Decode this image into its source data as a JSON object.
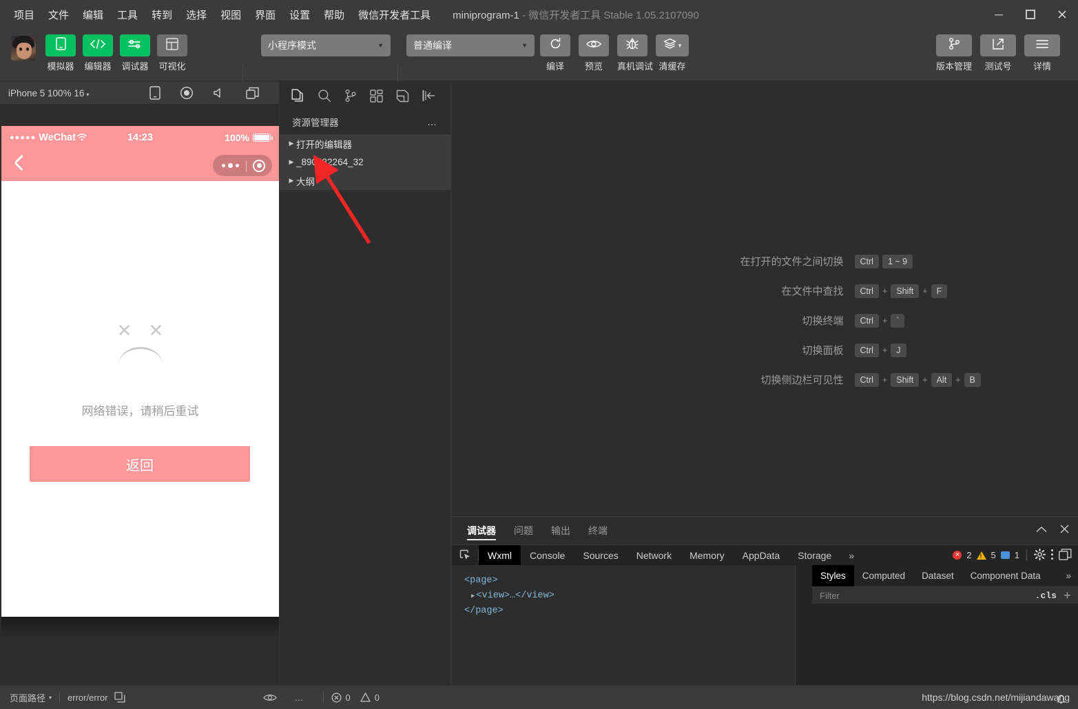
{
  "window": {
    "title_main": "miniprogram-1",
    "title_dash": "-",
    "title_sub": "微信开发者工具 Stable 1.05.2107090",
    "minimize": "minimize-button",
    "maximize": "maximize-button",
    "close": "close-button"
  },
  "menubar": {
    "items": [
      "项目",
      "文件",
      "编辑",
      "工具",
      "转到",
      "选择",
      "视图",
      "界面",
      "设置",
      "帮助",
      "微信开发者工具"
    ]
  },
  "toolbar": {
    "panel_buttons": [
      {
        "label": "模拟器",
        "icon": "phone-icon",
        "state": "active"
      },
      {
        "label": "编辑器",
        "icon": "code-icon",
        "state": "active"
      },
      {
        "label": "调试器",
        "icon": "debug-sliders-icon",
        "state": "active"
      },
      {
        "label": "可视化",
        "icon": "layout-icon",
        "state": "inactive"
      }
    ],
    "mode_select": {
      "value": "小程序模式",
      "caret": "▼"
    },
    "compile_select": {
      "value": "普通编译",
      "caret": "▼"
    },
    "actions": [
      {
        "label": "编译",
        "icon": "refresh-icon"
      },
      {
        "label": "预览",
        "icon": "eye-icon"
      },
      {
        "label": "真机调试",
        "icon": "bug-icon"
      },
      {
        "label": "清缓存",
        "icon": "layers-icon",
        "caret": "▾"
      }
    ],
    "right_actions": [
      {
        "label": "版本管理",
        "icon": "git-branch-icon"
      },
      {
        "label": "测试号",
        "icon": "external-link-icon"
      },
      {
        "label": "详情",
        "icon": "hamburger-icon"
      }
    ]
  },
  "simulator": {
    "device_label": "iPhone 5 100% 16",
    "device_caret": "▾",
    "toolbar_icons": [
      "device-rotate-icon",
      "record-icon",
      "volume-icon",
      "multi-window-icon"
    ],
    "status_bar": {
      "signal_dots": "●●●●●",
      "carrier": "WeChat",
      "wifi": "wifi-icon",
      "time": "14:23",
      "battery_percent": "100%"
    },
    "nav": {
      "back": "back-chevron-icon",
      "capsule_menu": "more-dots-icon",
      "capsule_target": "target-icon"
    },
    "page": {
      "face_icon": "sad-face-icon",
      "error_message": "网络错误，请稍后重试",
      "back_button": "返回"
    }
  },
  "explorer": {
    "activity_icons": [
      "files-icon",
      "search-icon",
      "source-control-icon",
      "extensions-icon",
      "snippets-icon",
      "collapse-sidebar-icon"
    ],
    "title": "资源管理器",
    "more": "…",
    "sections": [
      {
        "label": "打开的编辑器",
        "arrow": "▶"
      },
      {
        "label": "_890482264_32",
        "arrow": "▶"
      },
      {
        "label": "大纲",
        "arrow": "▶"
      }
    ]
  },
  "editor": {
    "shortcuts": [
      {
        "label": "在打开的文件之间切换",
        "keys": [
          "Ctrl",
          "1 ~ 9"
        ],
        "seps": [
          ""
        ]
      },
      {
        "label": "在文件中查找",
        "keys": [
          "Ctrl",
          "Shift",
          "F"
        ],
        "seps": [
          "+",
          "+"
        ]
      },
      {
        "label": "切换终端",
        "keys": [
          "Ctrl",
          "`"
        ],
        "seps": [
          "+"
        ]
      },
      {
        "label": "切换面板",
        "keys": [
          "Ctrl",
          "J"
        ],
        "seps": [
          "+"
        ]
      },
      {
        "label": "切换侧边栏可见性",
        "keys": [
          "Ctrl",
          "Shift",
          "Alt",
          "B"
        ],
        "seps": [
          "+",
          "+",
          "+"
        ]
      }
    ]
  },
  "debugger": {
    "panel_tabs": [
      {
        "label": "调试器",
        "active": true
      },
      {
        "label": "问题",
        "active": false
      },
      {
        "label": "输出",
        "active": false
      },
      {
        "label": "终端",
        "active": false
      }
    ],
    "panel_controls": [
      "chevron-up-icon",
      "close-icon"
    ],
    "devtools_tabs": [
      {
        "label": "Wxml",
        "active": true
      },
      {
        "label": "Console",
        "active": false
      },
      {
        "label": "Sources",
        "active": false
      },
      {
        "label": "Network",
        "active": false
      },
      {
        "label": "Memory",
        "active": false
      },
      {
        "label": "AppData",
        "active": false
      },
      {
        "label": "Storage",
        "active": false
      }
    ],
    "devtools_more": "»",
    "inspect_icon": "inspect-element-icon",
    "counters": {
      "errors": "2",
      "warnings": "5",
      "infos": "1"
    },
    "right_icons": [
      "gear-icon",
      "kebab-menu-icon",
      "dock-icon"
    ],
    "wxml_tree": [
      {
        "text": "<page>",
        "indent": 0,
        "arrow": ""
      },
      {
        "text": "<view>…</view>",
        "indent": 1,
        "arrow": "▶"
      },
      {
        "text": "</page>",
        "indent": 0,
        "arrow": ""
      }
    ],
    "styles": {
      "tabs": [
        {
          "label": "Styles",
          "active": true
        },
        {
          "label": "Computed",
          "active": false
        },
        {
          "label": "Dataset",
          "active": false
        },
        {
          "label": "Component Data",
          "active": false
        }
      ],
      "more": "»",
      "filter_placeholder": "Filter",
      "filter_value": "",
      "cls_button": ".cls",
      "add_button": "+"
    }
  },
  "statusbar": {
    "page_path_label": "页面路径",
    "page_path_caret": "▾",
    "route": "error/error",
    "copy_icon": "copy-icon",
    "eye_icon": "eye-icon",
    "more_icon": "…",
    "error_count": "0",
    "warning_count": "0",
    "watermark": "https://blog.csdn.net/mijiandawang"
  },
  "colors": {
    "accent_green": "#07c160",
    "wechat_pink": "#fb9798",
    "chrome_bg": "#3b3b3b",
    "panel_bg": "#2d2d2d",
    "annotation_red": "#f22525"
  }
}
